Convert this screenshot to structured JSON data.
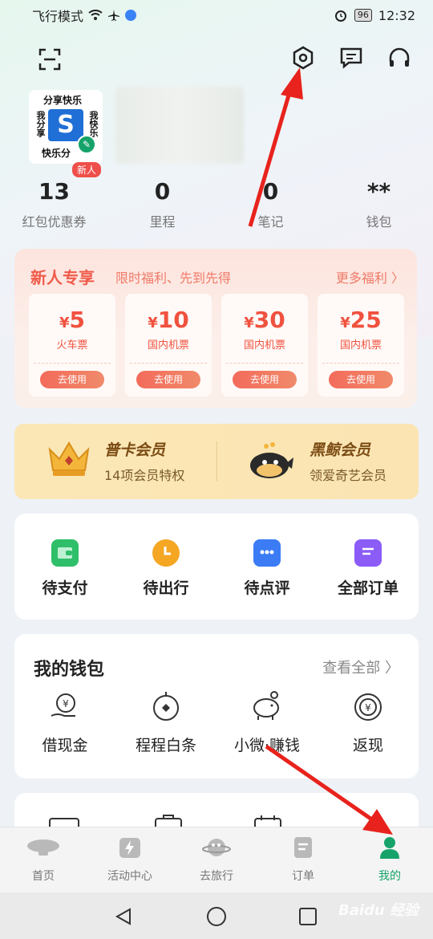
{
  "status_bar": {
    "mode": "飞行模式",
    "battery": "96",
    "time": "12:32"
  },
  "profile": {
    "avatar_top": "分享快乐",
    "avatar_left": "我分享",
    "avatar_right": "我快乐",
    "avatar_bottom": "快乐分",
    "avatar_letter": "S",
    "new_badge": "新人"
  },
  "stats": [
    {
      "value": "13",
      "label": "红包优惠券"
    },
    {
      "value": "0",
      "label": "里程"
    },
    {
      "value": "0",
      "label": "笔记"
    },
    {
      "value": "**",
      "label": "钱包"
    }
  ],
  "newcomer": {
    "title": "新人专享",
    "subtitle": "限时福利、先到先得",
    "more": "更多福利 〉",
    "coupons": [
      {
        "currency": "¥",
        "amount": "5",
        "name": "火车票",
        "button": "去使用"
      },
      {
        "currency": "¥",
        "amount": "10",
        "name": "国内机票",
        "button": "去使用"
      },
      {
        "currency": "¥",
        "amount": "30",
        "name": "国内机票",
        "button": "去使用"
      },
      {
        "currency": "¥",
        "amount": "25",
        "name": "国内机票",
        "button": "去使用"
      }
    ]
  },
  "membership": [
    {
      "title": "普卡会员",
      "subtitle": "14项会员特权"
    },
    {
      "title": "黑鲸会员",
      "subtitle": "领爱奇艺会员"
    }
  ],
  "orders": [
    {
      "label": "待支付",
      "icon": "wallet-icon",
      "color": "#2fbf6a"
    },
    {
      "label": "待出行",
      "icon": "clock-icon",
      "color": "#f5a623"
    },
    {
      "label": "待点评",
      "icon": "chat-icon",
      "color": "#3b7cf5"
    },
    {
      "label": "全部订单",
      "icon": "document-icon",
      "color": "#8b5cf6"
    }
  ],
  "wallet": {
    "title": "我的钱包",
    "more": "查看全部 〉",
    "items": [
      {
        "label": "借现金",
        "icon": "cash-hand-icon"
      },
      {
        "label": "程程白条",
        "icon": "coin-icon"
      },
      {
        "label": "小微·赚钱",
        "icon": "piggy-bank-icon"
      },
      {
        "label": "返现",
        "icon": "cashback-icon"
      }
    ]
  },
  "tabbar": [
    {
      "label": "首页",
      "icon": "airship-icon"
    },
    {
      "label": "活动中心",
      "icon": "lightning-icon"
    },
    {
      "label": "去旅行",
      "icon": "planet-icon"
    },
    {
      "label": "订单",
      "icon": "order-icon"
    },
    {
      "label": "我的",
      "icon": "person-icon",
      "active": true
    }
  ],
  "watermark": "Baidu 经验",
  "colors": {
    "accent": "#16a36a",
    "coupon_red": "#f0523f",
    "arrow_red": "#e8221c"
  }
}
